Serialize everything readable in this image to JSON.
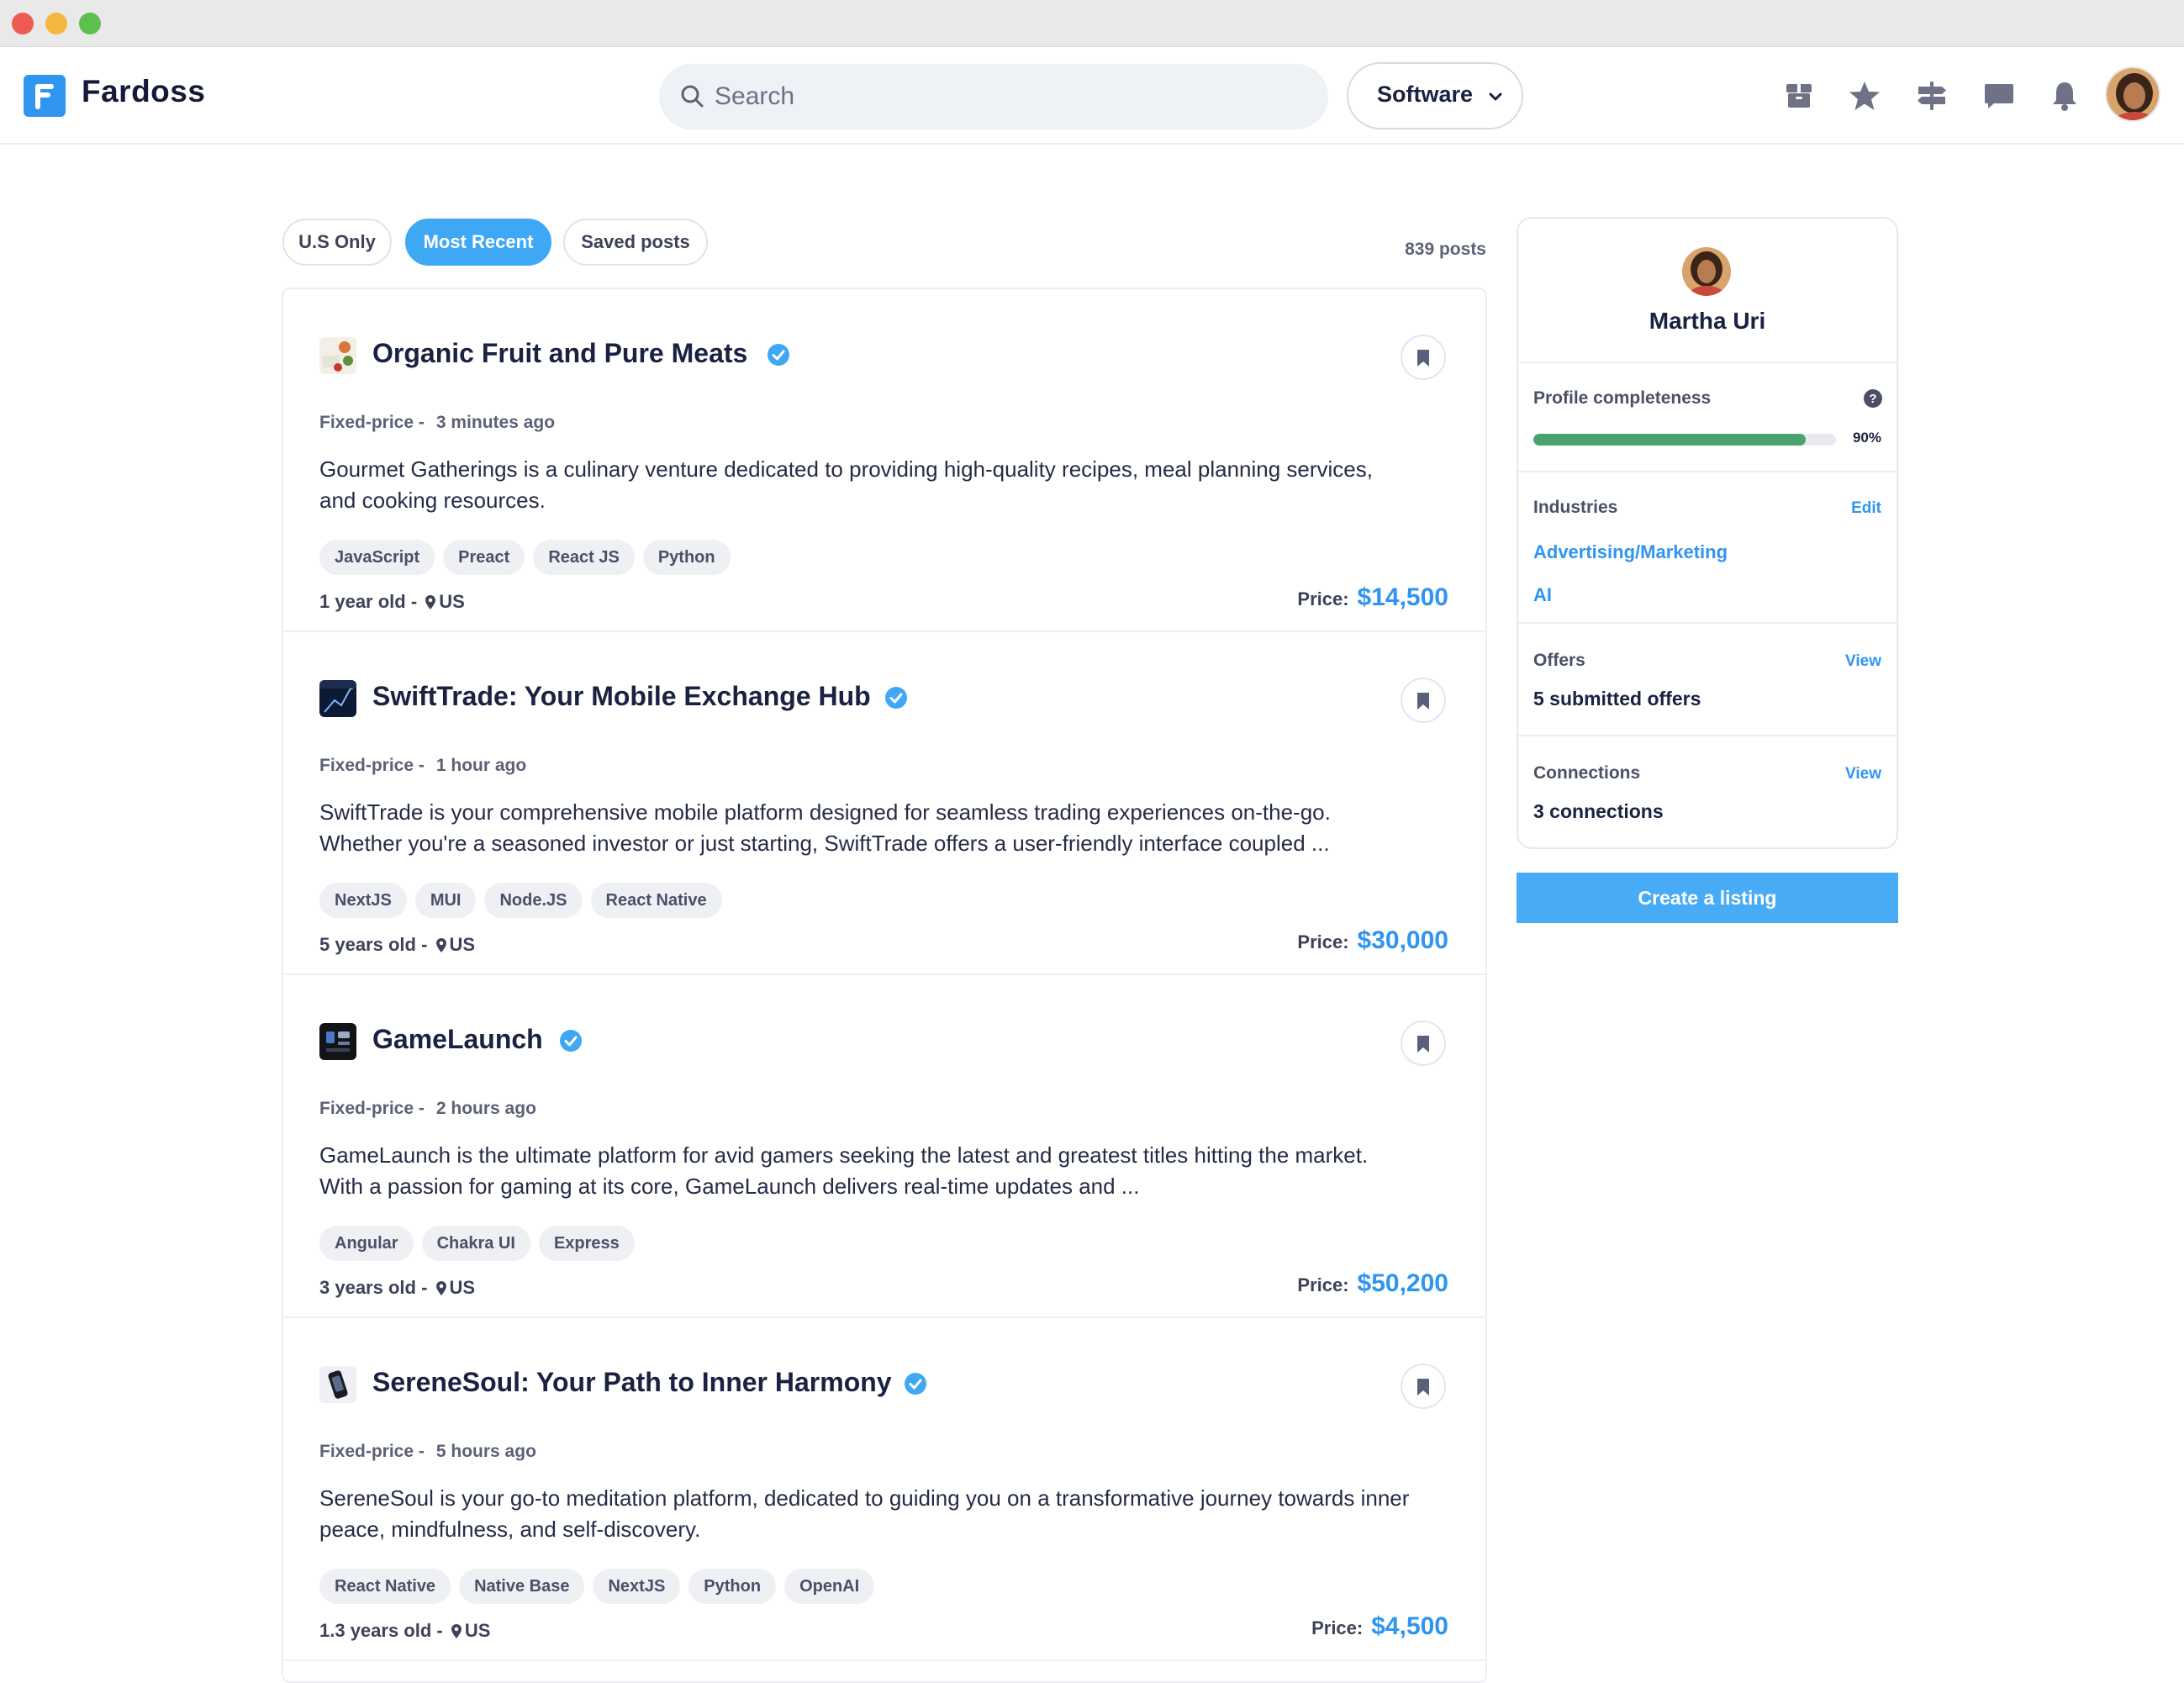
{
  "header": {
    "brand": "Fardoss",
    "search_placeholder": "Search",
    "category": "Software",
    "icons": [
      "box-icon",
      "star-icon",
      "signpost-icon",
      "chat-icon",
      "bell-icon"
    ],
    "accent_color": "#2f95f0"
  },
  "filters": {
    "items": [
      {
        "label": "U.S Only",
        "active": false
      },
      {
        "label": "Most Recent",
        "active": true
      },
      {
        "label": "Saved posts",
        "active": false
      }
    ],
    "count": "839 posts"
  },
  "posts": [
    {
      "title": "Organic Fruit and Pure Meats",
      "type": "Fixed-price -",
      "time": "3 minutes ago",
      "description": "Gourmet Gatherings is a culinary venture dedicated to providing high-quality recipes, meal planning services, and cooking resources.",
      "tags": [
        "JavaScript",
        "Preact",
        "React JS",
        "Python"
      ],
      "age": "1 year old -",
      "location": "US",
      "price_label": "Price:",
      "price": "$14,500"
    },
    {
      "title": "SwiftTrade: Your Mobile Exchange Hub",
      "type": "Fixed-price -",
      "time": "1 hour ago",
      "description": "SwiftTrade is your comprehensive mobile platform designed for seamless trading experiences on-the-go. Whether you're a seasoned investor or just starting, SwiftTrade offers a user-friendly interface coupled ...",
      "tags": [
        "NextJS",
        "MUI",
        "Node.JS",
        "React Native"
      ],
      "age": "5 years old -",
      "location": "US",
      "price_label": "Price:",
      "price": "$30,000"
    },
    {
      "title": "GameLaunch",
      "type": "Fixed-price -",
      "time": "2 hours ago",
      "description": "GameLaunch is the ultimate platform for avid gamers seeking the latest and greatest titles hitting the market. With a passion for gaming at its core, GameLaunch delivers real-time updates and ...",
      "tags": [
        "Angular",
        "Chakra UI",
        "Express"
      ],
      "age": "3 years old -",
      "location": "US",
      "price_label": "Price:",
      "price": "$50,200"
    },
    {
      "title": "SereneSoul: Your Path to Inner Harmony",
      "type": "Fixed-price -",
      "time": "5 hours ago",
      "description": "SereneSoul is your go-to meditation platform, dedicated to guiding you on a transformative journey towards inner peace, mindfulness, and self-discovery.",
      "tags": [
        "React Native",
        "Native Base",
        "NextJS",
        "Python",
        "OpenAI"
      ],
      "age": "1.3 years old -",
      "location": "US",
      "price_label": "Price:",
      "price": "$4,500"
    }
  ],
  "profile": {
    "name": "Martha Uri",
    "completeness_label": "Profile completeness",
    "completeness_value": 0.9,
    "completeness_text": "90%",
    "industries_label": "Industries",
    "industries_action": "Edit",
    "industries": [
      "Advertising/Marketing",
      "AI"
    ],
    "offers_label": "Offers",
    "offers_action": "View",
    "offers_value": "5 submitted offers",
    "connections_label": "Connections",
    "connections_action": "View",
    "connections_value": "3 connections"
  },
  "cta": {
    "label": "Create a listing"
  }
}
